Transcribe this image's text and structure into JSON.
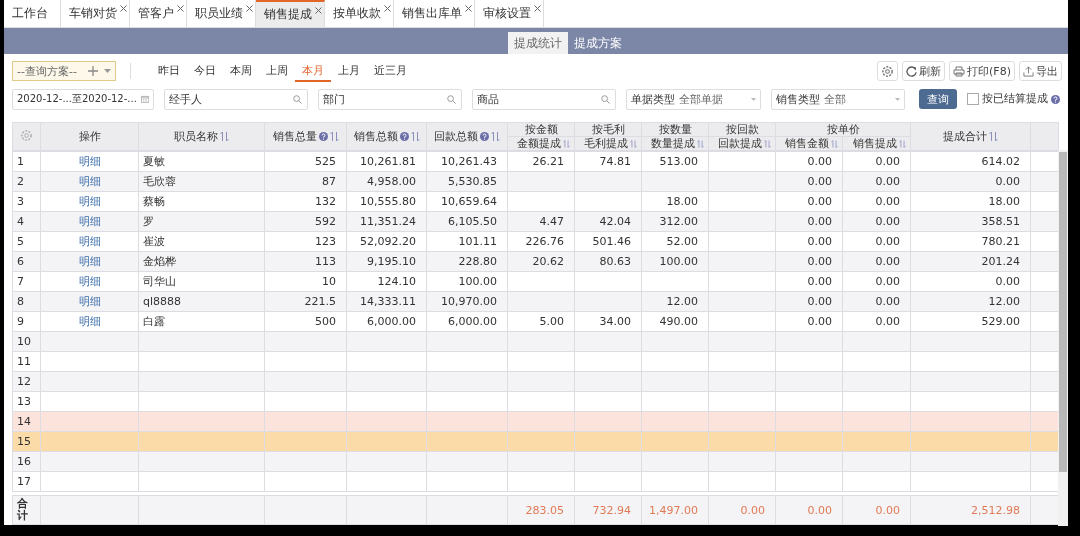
{
  "tabs": [
    {
      "label": "工作台",
      "closable": false,
      "selected": false
    },
    {
      "label": "车销对货",
      "closable": true,
      "selected": false
    },
    {
      "label": "管客户",
      "closable": true,
      "selected": false
    },
    {
      "label": "职员业绩",
      "closable": true,
      "selected": false
    },
    {
      "label": "销售提成",
      "closable": true,
      "selected": true
    },
    {
      "label": "按单收款",
      "closable": true,
      "selected": false
    },
    {
      "label": "销售出库单",
      "closable": true,
      "selected": false
    },
    {
      "label": "审核设置",
      "closable": true,
      "selected": false
    }
  ],
  "sub_tabs": [
    {
      "label": "提成统计",
      "selected": true
    },
    {
      "label": "提成方案",
      "selected": false
    }
  ],
  "query_scheme": {
    "placeholder": "--查询方案--"
  },
  "periods": [
    {
      "label": "昨日",
      "selected": false
    },
    {
      "label": "今日",
      "selected": false
    },
    {
      "label": "本周",
      "selected": false
    },
    {
      "label": "上周",
      "selected": false
    },
    {
      "label": "本月",
      "selected": true
    },
    {
      "label": "上月",
      "selected": false
    },
    {
      "label": "近三月",
      "selected": false
    }
  ],
  "actions": [
    {
      "kind": "settings"
    },
    {
      "kind": "refresh",
      "label": "刷新"
    },
    {
      "kind": "print",
      "label": "打印(F8)"
    },
    {
      "kind": "export",
      "label": "导出"
    }
  ],
  "filters": [
    {
      "kind": "date-range",
      "value": "2020-12-...至2020-12-..."
    },
    {
      "kind": "search",
      "placeholder": "经手人"
    },
    {
      "kind": "search",
      "placeholder": "部门"
    },
    {
      "kind": "search",
      "placeholder": "商品"
    },
    {
      "kind": "select",
      "label": "单据类型",
      "value": "全部单据"
    },
    {
      "kind": "select",
      "label": "销售类型",
      "value": "全部"
    }
  ],
  "query_button": "查询",
  "settled_checkbox": {
    "label": "按已结算提成",
    "checked": false
  },
  "table": {
    "header": [
      {
        "label": "操作"
      },
      {
        "label": "职员名称",
        "sortable": true
      },
      {
        "label": "销售总量",
        "help": true,
        "sortable": true
      },
      {
        "label": "销售总额",
        "help": true,
        "sortable": true
      },
      {
        "label": "回款总额",
        "help": true,
        "sortable": true
      },
      {
        "group": "按金额",
        "columns": [
          {
            "label": "金额提成",
            "sortable": true
          }
        ]
      },
      {
        "group": "按毛利",
        "columns": [
          {
            "label": "毛利提成",
            "sortable": true
          }
        ]
      },
      {
        "group": "按数量",
        "columns": [
          {
            "label": "数量提成",
            "sortable": true
          }
        ]
      },
      {
        "group": "按回款",
        "columns": [
          {
            "label": "回款提成",
            "sortable": true
          }
        ]
      },
      {
        "group": "按单价",
        "columns": [
          {
            "label": "销售金额",
            "sortable": true
          },
          {
            "label": "销售提成",
            "sortable": true
          }
        ]
      },
      {
        "label": "提成合计",
        "sortable": true
      }
    ],
    "rows": [
      {
        "no": "1",
        "action": "明细",
        "name": "夏敏",
        "qty": "525",
        "amount": "10,261.81",
        "refund": "10,261.43",
        "amt_comm": "26.21",
        "profit_comm": "74.81",
        "qty_comm": "513.00",
        "unit_sales": "0.00",
        "unit_comm": "0.00",
        "total": "614.02",
        "selected": false,
        "hovered": false
      },
      {
        "no": "2",
        "action": "明细",
        "name": "毛欣蓉",
        "qty": "87",
        "amount": "4,958.00",
        "refund": "5,530.85",
        "unit_sales": "0.00",
        "unit_comm": "0.00",
        "total": "0.00",
        "selected": false,
        "hovered": false
      },
      {
        "no": "3",
        "action": "明细",
        "name": "蔡畅",
        "qty": "132",
        "amount": "10,555.80",
        "refund": "10,659.64",
        "qty_comm": "18.00",
        "unit_sales": "0.00",
        "unit_comm": "0.00",
        "total": "18.00",
        "selected": false,
        "hovered": false
      },
      {
        "no": "4",
        "action": "明细",
        "name": "罗",
        "qty": "592",
        "amount": "11,351.24",
        "refund": "6,105.50",
        "amt_comm": "4.47",
        "profit_comm": "42.04",
        "qty_comm": "312.00",
        "unit_sales": "0.00",
        "unit_comm": "0.00",
        "total": "358.51",
        "selected": false,
        "hovered": false
      },
      {
        "no": "5",
        "action": "明细",
        "name": "崔波",
        "qty": "123",
        "amount": "52,092.20",
        "refund": "101.11",
        "amt_comm": "226.76",
        "profit_comm": "501.46",
        "qty_comm": "52.00",
        "unit_sales": "0.00",
        "unit_comm": "0.00",
        "total": "780.21",
        "selected": false,
        "hovered": false
      },
      {
        "no": "6",
        "action": "明细",
        "name": "金焰桦",
        "qty": "113",
        "amount": "9,195.10",
        "refund": "228.80",
        "amt_comm": "20.62",
        "profit_comm": "80.63",
        "qty_comm": "100.00",
        "unit_sales": "0.00",
        "unit_comm": "0.00",
        "total": "201.24",
        "selected": false,
        "hovered": false
      },
      {
        "no": "7",
        "action": "明细",
        "name": "司华山",
        "qty": "10",
        "amount": "124.10",
        "refund": "100.00",
        "unit_sales": "0.00",
        "unit_comm": "0.00",
        "total": "0.00",
        "selected": false,
        "hovered": false
      },
      {
        "no": "8",
        "action": "明细",
        "name": "ql8888",
        "qty": "221.5",
        "amount": "14,333.11",
        "refund": "10,970.00",
        "qty_comm": "12.00",
        "unit_sales": "0.00",
        "unit_comm": "0.00",
        "total": "12.00",
        "selected": false,
        "hovered": false
      },
      {
        "no": "9",
        "action": "明细",
        "name": "白露",
        "qty": "500",
        "amount": "6,000.00",
        "refund": "6,000.00",
        "amt_comm": "5.00",
        "profit_comm": "34.00",
        "qty_comm": "490.00",
        "unit_sales": "0.00",
        "unit_comm": "0.00",
        "total": "529.00",
        "selected": false,
        "hovered": false
      },
      {
        "no": "10",
        "selected": false,
        "hovered": false
      },
      {
        "no": "11",
        "selected": false,
        "hovered": false
      },
      {
        "no": "12",
        "selected": false,
        "hovered": false
      },
      {
        "no": "13",
        "selected": false,
        "hovered": false
      },
      {
        "no": "14",
        "selected": false,
        "hovered": true
      },
      {
        "no": "15",
        "selected": true,
        "hovered": false
      },
      {
        "no": "16",
        "selected": false,
        "hovered": false
      },
      {
        "no": "17",
        "selected": false,
        "hovered": false
      }
    ],
    "footer": {
      "label": "合计",
      "amt_comm": "283.05",
      "profit_comm": "732.94",
      "qty_comm": "1,497.00",
      "refund_comm": "0.00",
      "unit_sales": "0.00",
      "unit_comm": "0.00",
      "total": "2,512.98"
    }
  }
}
